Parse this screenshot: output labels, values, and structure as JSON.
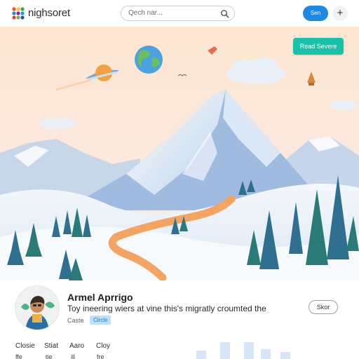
{
  "header": {
    "brand": "nighsoret",
    "search_placeholder": "Qech nar...",
    "button_label": "Sen",
    "plus_label": "+"
  },
  "hero": {
    "cta_label": "Read Severe"
  },
  "profile": {
    "name": "Armel Aprrigo",
    "description": "Toy ineering wiers at vine this's migratly croumted the",
    "tag_label": "Caste",
    "tag_value": "Circle",
    "follow_label": "Skor"
  },
  "stats": [
    {
      "label": "Closie",
      "value": "ffe"
    },
    {
      "label": "Stiat",
      "value": "tie"
    },
    {
      "label": "Aaro",
      "value": "ill"
    },
    {
      "label": "Cloy",
      "value": "fre"
    }
  ],
  "colors": {
    "accent": "#1e88e5",
    "cta": "#18c2a8",
    "chip_bg": "#bfe0fb",
    "road": "#f4a462"
  },
  "icons": {
    "logo": "multicolor-dots-logo",
    "search": "search-icon",
    "plus": "plus-icon"
  }
}
